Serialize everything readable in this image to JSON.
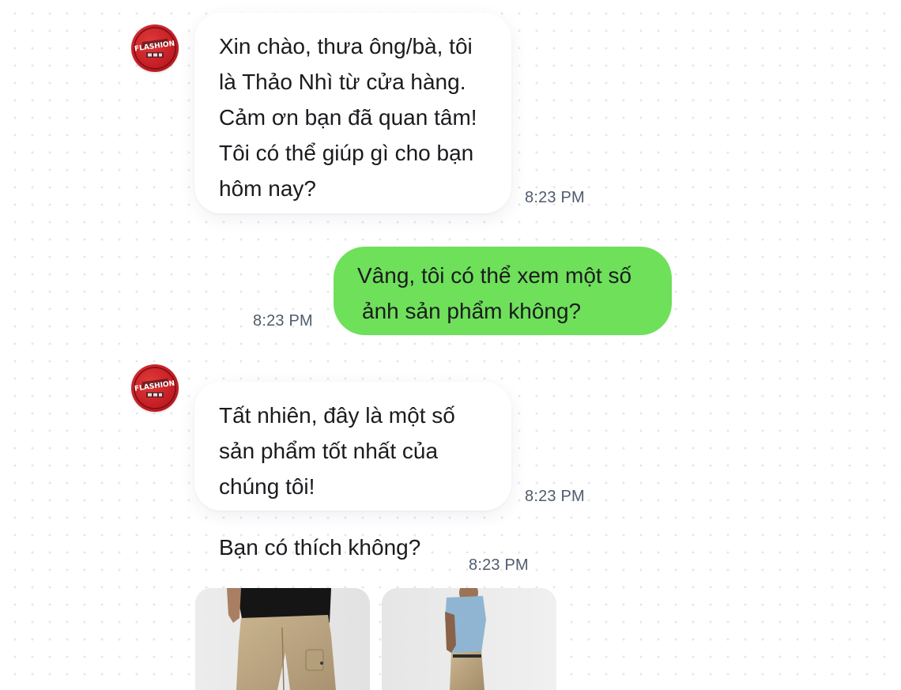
{
  "store": {
    "avatar_text": "FLASHION"
  },
  "messages": [
    {
      "id": "m1",
      "direction": "incoming",
      "lines": [
        "Xin chào, thưa ông/bà, tôi",
        "là Thảo Nhì từ cửa hàng.",
        "Cảm ơn bạn đã quan tâm!",
        "Tôi có thể giúp gì cho bạn",
        "hôm nay?"
      ],
      "time": "8:23 PM"
    },
    {
      "id": "m2",
      "direction": "outgoing",
      "lines": [
        "Vâng, tôi có thể xem một số",
        "ảnh sản phẩm không?"
      ],
      "time": "8:23 PM"
    },
    {
      "id": "m3",
      "direction": "incoming",
      "lines": [
        "Tất nhiên, đây là một số",
        "sản phẩm tốt nhất của",
        "chúng tôi!"
      ],
      "time": "8:23 PM"
    },
    {
      "id": "m4",
      "direction": "incoming",
      "text": "Bạn có thích không?",
      "time": "8:23 PM"
    }
  ],
  "colors": {
    "outgoing_bubble": "#6ee05a",
    "incoming_bubble": "#ffffff",
    "timestamp": "#4f5b6e",
    "avatar": "#c61f26"
  },
  "product_images": [
    {
      "name": "khaki-cargo-pants-black-tee",
      "icon": "product-photo"
    },
    {
      "name": "khaki-pants-blue-tee",
      "icon": "product-photo"
    }
  ]
}
